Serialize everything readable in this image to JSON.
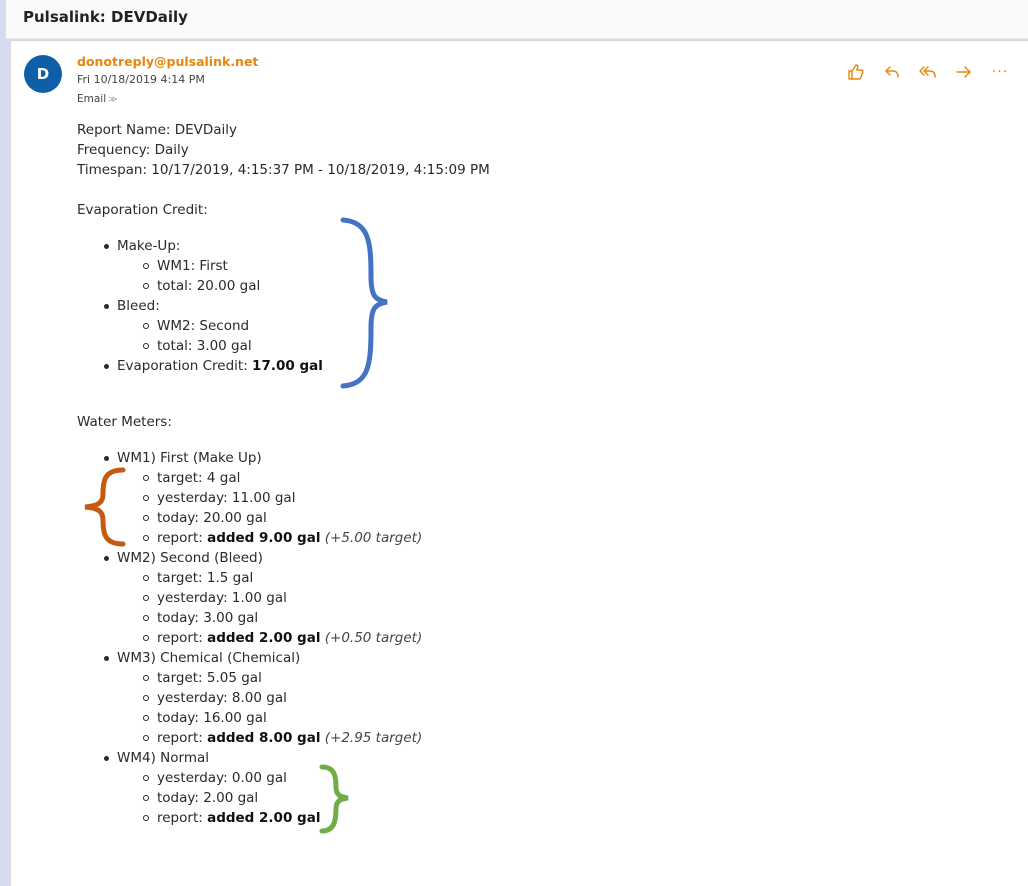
{
  "window": {
    "subject": "Pulsalink: DEVDaily"
  },
  "header": {
    "avatar_letter": "D",
    "sender": "donotreply@pulsalink.net",
    "date": "Fri 10/18/2019 4:14 PM",
    "tag": "Email",
    "tag_chevron": "≫",
    "more": "···"
  },
  "report": {
    "name": "Report Name: DEVDaily",
    "frequency": "Frequency: Daily",
    "timespan": "Timespan: 10/17/2019, 4:15:37 PM - 10/18/2019, 4:15:09 PM"
  },
  "evap": {
    "heading": "Evaporation Credit:",
    "makeup_label": "Make-Up:",
    "makeup_meter": "WM1: First",
    "makeup_total": "total: 20.00 gal",
    "bleed_label": "Bleed:",
    "bleed_meter": "WM2: Second",
    "bleed_total": "total: 3.00 gal",
    "credit_label": "Evaporation Credit: ",
    "credit_value": "17.00 gal"
  },
  "meters": {
    "heading": "Water Meters:",
    "items": [
      {
        "title": "WM1) First (Make Up)",
        "target": "target: 4 gal",
        "yesterday": "yesterday: 11.00 gal",
        "today": "today: 20.00 gal",
        "report_label": "report: ",
        "report_value": "added 9.00 gal",
        "report_note": " (+5.00 target)"
      },
      {
        "title": "WM2) Second (Bleed)",
        "target": "target: 1.5 gal",
        "yesterday": "yesterday: 1.00 gal",
        "today": "today: 3.00 gal",
        "report_label": "report: ",
        "report_value": "added 2.00 gal",
        "report_note": " (+0.50 target)"
      },
      {
        "title": "WM3) Chemical (Chemical)",
        "target": "target: 5.05 gal",
        "yesterday": "yesterday: 8.00 gal",
        "today": "today: 16.00 gal",
        "report_label": "report: ",
        "report_value": "added 8.00 gal",
        "report_note": " (+2.95 target)"
      },
      {
        "title": "WM4) Normal",
        "yesterday": "yesterday: 0.00 gal",
        "today": "today: 2.00 gal",
        "report_label": "report: ",
        "report_value": "added 2.00 gal"
      }
    ]
  },
  "icons": [
    "like-icon",
    "reply-icon",
    "reply-all-icon",
    "forward-icon",
    "more-icon"
  ],
  "colors": {
    "accent": "#e8860c",
    "avatar": "#0f5fa8",
    "brace_blue": "#4472c4",
    "brace_orange": "#c55a11",
    "brace_green": "#70ad47"
  }
}
